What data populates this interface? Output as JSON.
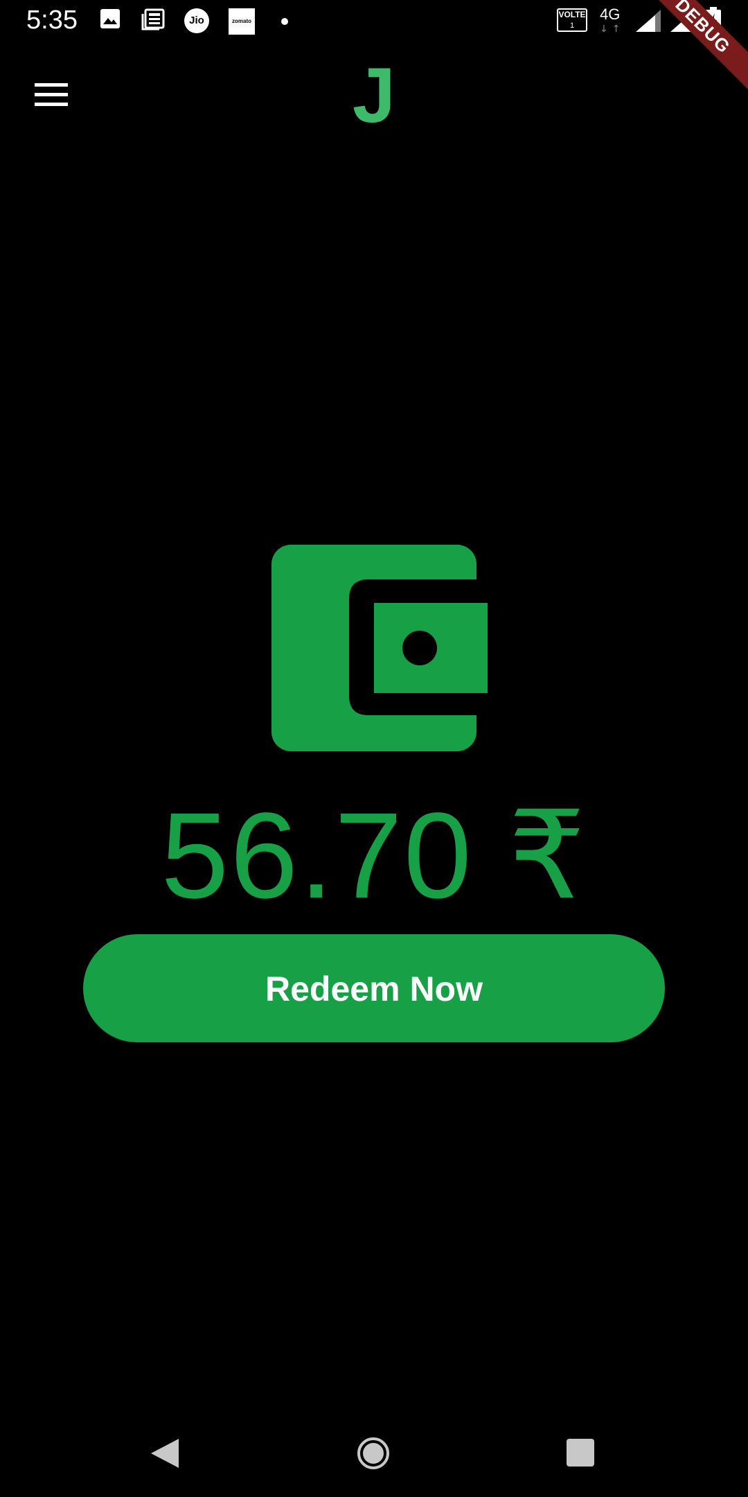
{
  "status_bar": {
    "time": "5:35",
    "jio_label": "Jio",
    "zomato_label": "zomato",
    "volte_label": "VOLTE",
    "volte_sim": "1",
    "network_type": "4G",
    "network_arrows": "↓↑"
  },
  "debug_banner": "DEBUG",
  "app_bar": {
    "logo": "J"
  },
  "wallet": {
    "balance": "56.70 ₹"
  },
  "actions": {
    "redeem_label": "Redeem Now"
  },
  "colors": {
    "accent": "#17a046",
    "logo": "#3dba6a",
    "background": "#000000",
    "debug_banner": "#7a1c1c"
  },
  "icons": {
    "menu": "hamburger-menu-icon",
    "wallet": "wallet-icon",
    "nav_back": "back-triangle-icon",
    "nav_home": "home-circle-icon",
    "nav_recents": "recents-square-icon"
  }
}
